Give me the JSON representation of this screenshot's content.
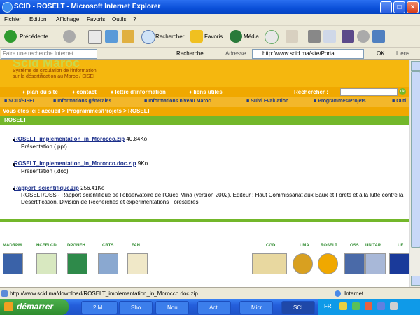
{
  "window": {
    "title": "SCID - ROSELT - Microsoft Internet Explorer"
  },
  "menu": [
    "Fichier",
    "Edition",
    "Affichage",
    "Favoris",
    "Outils",
    "?"
  ],
  "toolbar": {
    "back": "Précédente",
    "search": "Rechercher",
    "favorites": "Favoris",
    "media": "Média"
  },
  "searchbar": {
    "placeholder": "Faire une recherche Internet",
    "search_btn": "Recherche",
    "address_label": "Adresse",
    "url": "http://www.scid.ma/site/Portal",
    "go": "OK",
    "links": "Liens"
  },
  "site": {
    "tagline1": "Système de circulation de l'information",
    "tagline2": "sur la désertification au Maroc / SISEI",
    "nav": [
      "plan du site",
      "contact",
      "lettre d'information",
      "liens utiles"
    ],
    "search_label": "Rechercher :",
    "search_go": "ok",
    "menu2": [
      "SCID/SISEI",
      "Informations générales",
      "Informations niveau Maroc",
      "Suivi Evaluation",
      "Programmes/Projets",
      "Outi"
    ],
    "breadcrumb": "Vous êtes ici : accueil > Programmes/Projets > ROSELT",
    "section": "ROSELT"
  },
  "files": [
    {
      "link": "ROSELT_implementation_in_Morocco.zip",
      "size": "40.84Ko",
      "desc": "Présentation (.ppt)"
    },
    {
      "link": "ROSELT_implementation_in_Morocco.doc.zip",
      "size": "9Ko",
      "desc": "Présentation (.doc)"
    },
    {
      "link": "Rapport_scientifique.zip",
      "size": "256.41Ko",
      "desc": "ROSELT/OSS - Rapport scientifique de l'observatoire de l'Oued Mina (version 2002). Editeur : Haut Commissariat aux Eaux et Forêts et à la lutte contre la Désertification. Division de Recherches et expérimentations Forestières."
    }
  ],
  "partners_left": [
    "MADRPM",
    "HCEFLCD",
    "DPGNEH",
    "CRTS",
    "FAN"
  ],
  "partners_right": [
    "CGD",
    "UMA",
    "ROSELT",
    "OSS",
    "UNITAR",
    "UE"
  ],
  "status": {
    "url": "http://www.scid.ma/download/ROSELT_implementation_in_Morocco.doc.zip",
    "zone": "Internet"
  },
  "taskbar": {
    "start": "démarrer",
    "tasks": [
      "2 M...",
      "Sho...",
      "Nou...",
      "Acti...",
      "Micr...",
      "SCI..."
    ],
    "tray_lang": "FR"
  },
  "colors": {
    "header": "#f5b70e",
    "nav": "#f0a800",
    "section_bar": "#73b72a",
    "link": "#1a2e8a"
  }
}
